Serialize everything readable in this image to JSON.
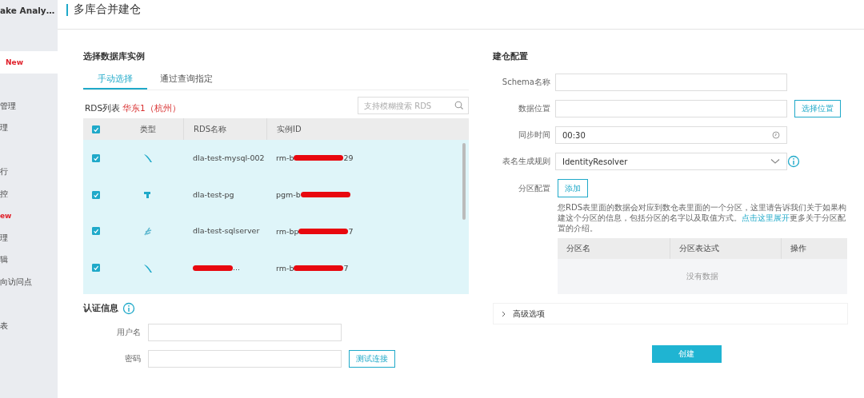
{
  "sidebar": {
    "title": "ake Analy…",
    "items": [
      {
        "text": "New",
        "kind": "badge",
        "selected": true
      },
      {
        "text": "管理",
        "kind": "plain",
        "selected": false,
        "gap_before": true
      },
      {
        "text": "理",
        "kind": "plain",
        "selected": false
      },
      {
        "text": "行",
        "kind": "plain",
        "selected": false,
        "gap_before": true
      },
      {
        "text": "控",
        "kind": "plain",
        "selected": false
      },
      {
        "text": "ew",
        "kind": "badge",
        "selected": false
      },
      {
        "text": "理",
        "kind": "plain",
        "selected": false
      },
      {
        "text": "辑",
        "kind": "plain",
        "selected": false
      },
      {
        "text": "向访问点",
        "kind": "plain",
        "selected": false
      },
      {
        "text": "表",
        "kind": "plain",
        "selected": false,
        "gap_before": true
      }
    ]
  },
  "page_title": "多库合并建仓",
  "instances": {
    "heading": "选择数据库实例",
    "tabs": [
      {
        "label": "手动选择",
        "selected": true
      },
      {
        "label": "通过查询指定",
        "selected": false
      }
    ],
    "list_label": "RDS列表",
    "region": "华东1（杭州）",
    "search": {
      "placeholder": "支持模糊搜索 RDS"
    },
    "table": {
      "all_checked": true,
      "columns": [
        "类型",
        "RDS名称",
        "实例ID"
      ],
      "rows": [
        {
          "checked": true,
          "kind": "mysql",
          "name": {
            "before": "dla-test-mysql-002"
          },
          "id": {
            "before": "rm-b",
            "redacted": true,
            "after": "29"
          }
        },
        {
          "checked": true,
          "kind": "pg",
          "name": {
            "before": "dla-test-pg"
          },
          "id": {
            "before": "pgm-b",
            "redacted": true
          }
        },
        {
          "checked": true,
          "kind": "sqlserver",
          "name": {
            "before": "dla-test-sqlserver"
          },
          "id": {
            "before": "rm-bp",
            "redacted": true,
            "after": "7"
          }
        },
        {
          "checked": true,
          "kind": "mysql",
          "name": {
            "redacted": true,
            "after": "..."
          },
          "id": {
            "before": "rm-b",
            "redacted": true,
            "after": "7"
          }
        }
      ]
    }
  },
  "auth": {
    "heading": "认证信息",
    "fields": [
      {
        "label": "用户名"
      },
      {
        "label": "密码"
      }
    ],
    "test_button": "测试连接"
  },
  "config": {
    "heading": "建仓配置",
    "fields": [
      {
        "label": "Schema名称",
        "kind": "text"
      },
      {
        "label": "数据位置",
        "kind": "text",
        "button": "选择位置"
      },
      {
        "label": "同步时间",
        "kind": "time",
        "value": "00:30"
      },
      {
        "label": "表名生成规则",
        "kind": "select",
        "value": "IdentityResolver",
        "info": true
      }
    ],
    "partition": {
      "label": "分区配置",
      "add_button": "添加",
      "description": {
        "before": "您RDS表里面的数据会对应到数仓表里面的一个分区，这里请告诉我们关于如果构建这个分区的信息，包括分区的名字以及取值方式。",
        "link": "点击这里展开",
        "after": "更多关于分区配置的介绍。"
      },
      "columns": [
        "分区名",
        "分区表达式",
        "操作"
      ],
      "empty": "没有数据"
    },
    "advanced": {
      "label": "高级选项",
      "expanded": false
    },
    "create_button": "创建"
  }
}
